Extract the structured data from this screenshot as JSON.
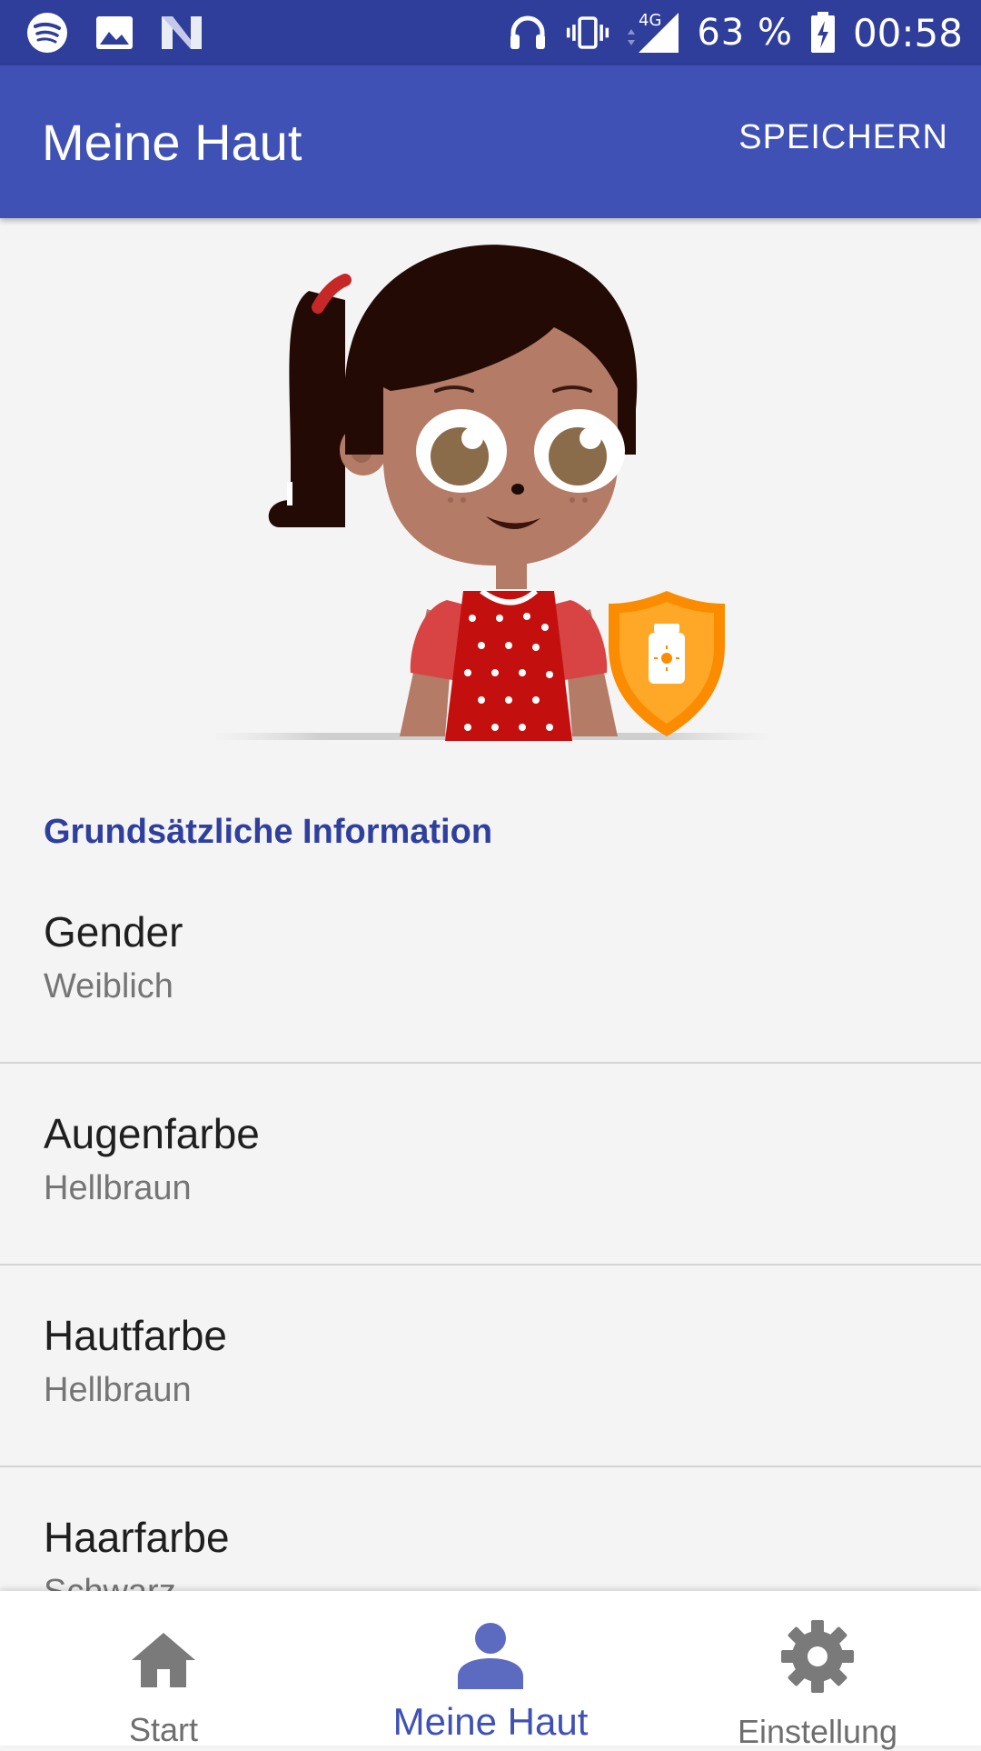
{
  "status_bar": {
    "network": "4G",
    "battery": "63 %",
    "time": "00:58",
    "icons": [
      "spotify-icon",
      "image-icon",
      "n-icon",
      "headphones-icon",
      "vibrate-icon",
      "signal-icon",
      "battery-charging-icon"
    ]
  },
  "app_bar": {
    "title": "Meine Haut",
    "save_label": "SPEICHERN"
  },
  "section": {
    "header": "Grundsätzliche Information"
  },
  "items": [
    {
      "title": "Gender",
      "value": "Weiblich"
    },
    {
      "title": "Augenfarbe",
      "value": "Hellbraun"
    },
    {
      "title": "Hautfarbe",
      "value": "Hellbraun"
    },
    {
      "title": "Haarfarbe",
      "value": "Schwarz"
    }
  ],
  "bottom_nav": {
    "items": [
      {
        "label": "Start",
        "icon": "home-icon",
        "active": false
      },
      {
        "label": "Meine Haut",
        "icon": "person-icon",
        "active": true
      },
      {
        "label": "Einstellung",
        "icon": "gear-icon",
        "active": false
      }
    ]
  },
  "colors": {
    "status_bar": "#2f3d9b",
    "app_bar": "#3f51b5",
    "accent": "#3f51b5",
    "section_header": "#2f3f9e",
    "shield": "#ff9800"
  }
}
